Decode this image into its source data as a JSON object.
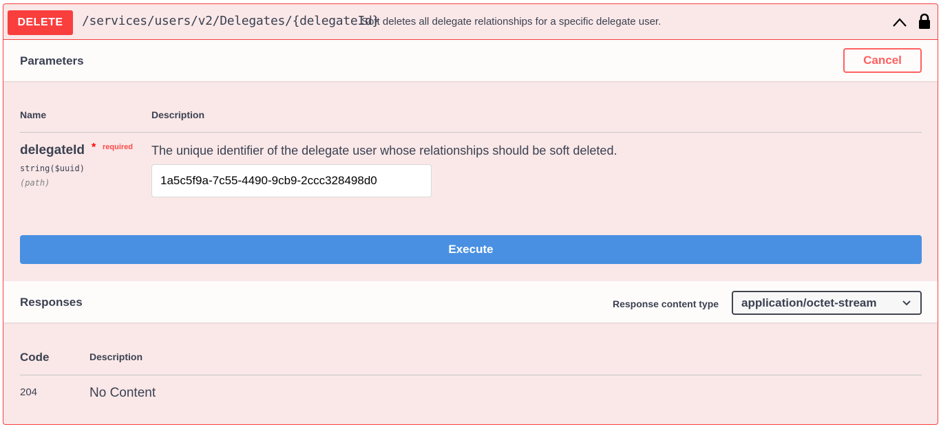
{
  "summary": {
    "method": "DELETE",
    "path": "/services/users/v2/Delegates/{delegateId}",
    "description": "Soft deletes all delegate relationships for a specific delegate user.",
    "expand_icon": "chevron-up-icon",
    "auth_icon": "lock-icon"
  },
  "parameters": {
    "title": "Parameters",
    "cancel_label": "Cancel",
    "col_name": "Name",
    "col_description": "Description",
    "items": [
      {
        "name": "delegateId",
        "required_star": "*",
        "required_label": "required",
        "type": "string($uuid)",
        "in": "(path)",
        "description": "The unique identifier of the delegate user whose relationships should be soft deleted.",
        "value": "1a5c5f9a-7c55-4490-9cb9-2ccc328498d0"
      }
    ]
  },
  "execute_label": "Execute",
  "responses": {
    "title": "Responses",
    "content_type_label": "Response content type",
    "content_type_value": "application/octet-stream",
    "col_code": "Code",
    "col_description": "Description",
    "items": [
      {
        "code": "204",
        "description": "No Content"
      }
    ]
  },
  "colors": {
    "delete": "#f93e3e",
    "background": "#fae8e8",
    "execute": "#4990e2",
    "cancel": "#ff6060"
  }
}
